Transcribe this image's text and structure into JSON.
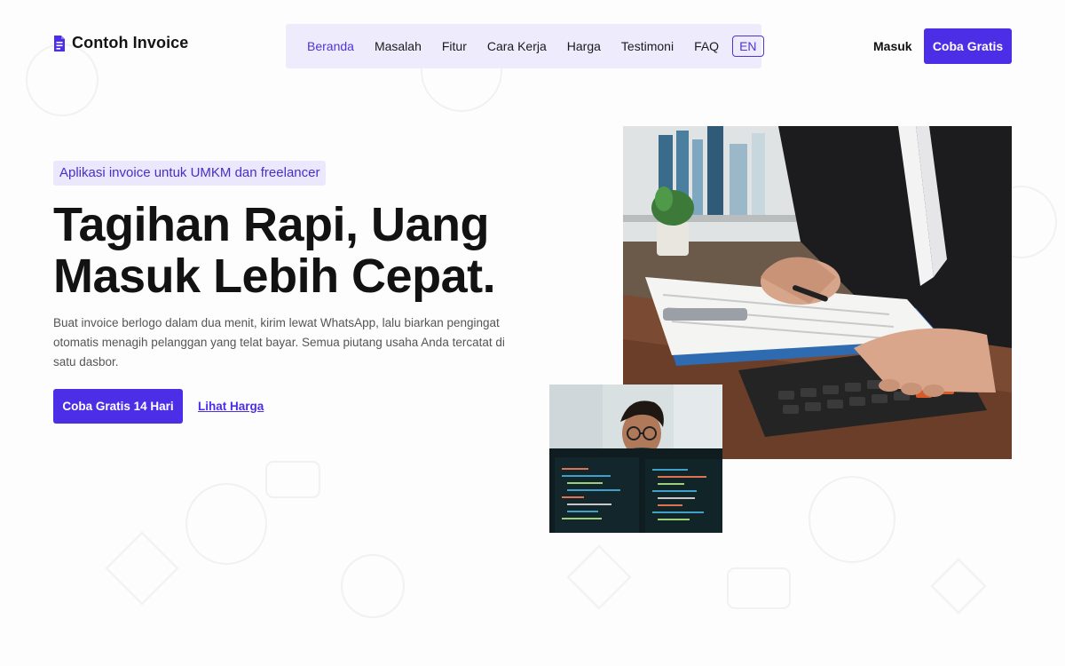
{
  "brand": {
    "name": "Contoh Invoice",
    "accent": "#4b2ee6",
    "logo_icon": "invoice-document-icon"
  },
  "nav": {
    "items": [
      {
        "label": "Beranda",
        "active": true
      },
      {
        "label": "Masalah",
        "active": false
      },
      {
        "label": "Fitur",
        "active": false
      },
      {
        "label": "Cara Kerja",
        "active": false
      },
      {
        "label": "Harga",
        "active": false
      },
      {
        "label": "Testimoni",
        "active": false
      },
      {
        "label": "FAQ",
        "active": false
      }
    ],
    "language": "EN"
  },
  "header": {
    "login_label": "Masuk",
    "cta_label": "Coba Gratis"
  },
  "hero": {
    "badge": "Aplikasi invoice untuk UMKM dan freelancer",
    "title_line1": "Tagihan Rapi, Uang",
    "title_line2": "Masuk Lebih Cepat.",
    "description": "Buat invoice berlogo dalam dua menit, kirim lewat WhatsApp, lalu biarkan pengingat otomatis menagih pelanggan yang telat bayar. Semua piutang usaha Anda tercatat di satu dasbor.",
    "primary_cta": "Coba Gratis 14 Hari",
    "secondary_cta": "Lihat Harga"
  },
  "images": {
    "main": "photo-accountant-calculator",
    "secondary": "photo-developer-at-monitor"
  }
}
